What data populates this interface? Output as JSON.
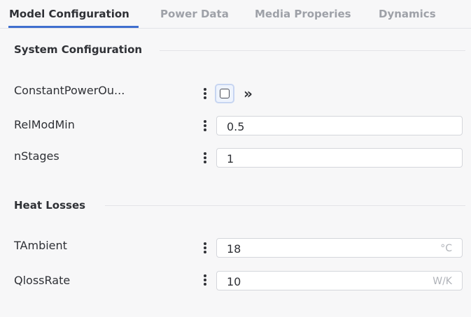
{
  "tabs": [
    {
      "label": "Model Configuration"
    },
    {
      "label": "Power Data"
    },
    {
      "label": "Media Properies"
    },
    {
      "label": "Dynamics"
    }
  ],
  "sections": {
    "system_configuration": {
      "title": "System Configuration",
      "rows": {
        "constant_power": {
          "label": "ConstantPowerOu...",
          "checked": false,
          "expand_icon": "double-chevron-right-icon",
          "expand_glyph": "»"
        },
        "relmodmin": {
          "label": "RelModMin",
          "value": "0.5"
        },
        "nstages": {
          "label": "nStages",
          "value": "1"
        }
      }
    },
    "heat_losses": {
      "title": "Heat Losses",
      "rows": {
        "tambient": {
          "label": "TAmbient",
          "value": "18",
          "unit": "°C"
        },
        "qlossrate": {
          "label": "QlossRate",
          "value": "10",
          "unit": "W/K"
        }
      }
    }
  },
  "icons": {
    "row_menu": "kebab-menu-icon"
  },
  "colors": {
    "accent": "#3f6fcf",
    "background": "#f7f7f8",
    "field_bg": "#ffffff",
    "unit_text": "#b0b3b9"
  }
}
